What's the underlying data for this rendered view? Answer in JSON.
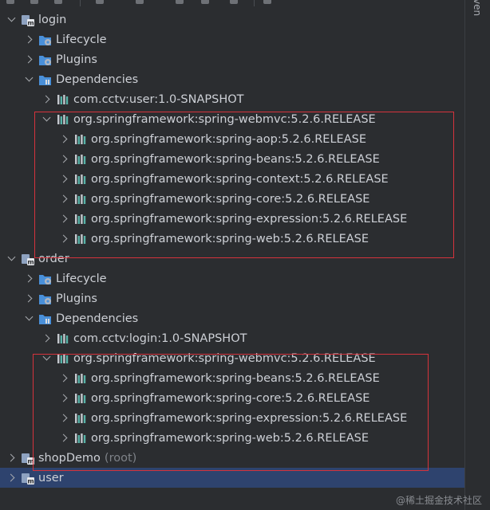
{
  "toolbar": {
    "icons": [
      "refresh-icon",
      "reimport-icon",
      "add-icon",
      "download-icon",
      "run-icon",
      "toggle-offline-icon",
      "settings-icon",
      "expand-icon"
    ]
  },
  "side_panel": {
    "label": "ven"
  },
  "colors": {
    "background": "#2b2d30",
    "selection": "#2e436e",
    "highlight_box": "#d5333c",
    "folder_blue": "#4a90d9",
    "module_gray": "#9aa0a6"
  },
  "tree": [
    {
      "indent": 0,
      "expanded": true,
      "icon": "maven-module-icon",
      "label": "login",
      "suffix": ""
    },
    {
      "indent": 1,
      "expanded": false,
      "icon": "lifecycle-icon",
      "label": "Lifecycle",
      "suffix": ""
    },
    {
      "indent": 1,
      "expanded": false,
      "icon": "plugins-icon",
      "label": "Plugins",
      "suffix": ""
    },
    {
      "indent": 1,
      "expanded": true,
      "icon": "dependencies-icon",
      "label": "Dependencies",
      "suffix": ""
    },
    {
      "indent": 2,
      "expanded": false,
      "icon": "library-icon",
      "label": "com.cctv:user:1.0-SNAPSHOT",
      "suffix": ""
    },
    {
      "indent": 2,
      "expanded": true,
      "icon": "library-icon",
      "label": "org.springframework:spring-webmvc:5.2.6.RELEASE",
      "suffix": ""
    },
    {
      "indent": 3,
      "expanded": false,
      "icon": "library-icon",
      "label": "org.springframework:spring-aop:5.2.6.RELEASE",
      "suffix": ""
    },
    {
      "indent": 3,
      "expanded": false,
      "icon": "library-icon",
      "label": "org.springframework:spring-beans:5.2.6.RELEASE",
      "suffix": ""
    },
    {
      "indent": 3,
      "expanded": false,
      "icon": "library-icon",
      "label": "org.springframework:spring-context:5.2.6.RELEASE",
      "suffix": ""
    },
    {
      "indent": 3,
      "expanded": false,
      "icon": "library-icon",
      "label": "org.springframework:spring-core:5.2.6.RELEASE",
      "suffix": ""
    },
    {
      "indent": 3,
      "expanded": false,
      "icon": "library-icon",
      "label": "org.springframework:spring-expression:5.2.6.RELEASE",
      "suffix": ""
    },
    {
      "indent": 3,
      "expanded": false,
      "icon": "library-icon",
      "label": "org.springframework:spring-web:5.2.6.RELEASE",
      "suffix": ""
    },
    {
      "indent": 0,
      "expanded": true,
      "icon": "maven-module-icon",
      "label": "order",
      "suffix": ""
    },
    {
      "indent": 1,
      "expanded": false,
      "icon": "lifecycle-icon",
      "label": "Lifecycle",
      "suffix": ""
    },
    {
      "indent": 1,
      "expanded": false,
      "icon": "plugins-icon",
      "label": "Plugins",
      "suffix": ""
    },
    {
      "indent": 1,
      "expanded": true,
      "icon": "dependencies-icon",
      "label": "Dependencies",
      "suffix": ""
    },
    {
      "indent": 2,
      "expanded": false,
      "icon": "library-icon",
      "label": "com.cctv:login:1.0-SNAPSHOT",
      "suffix": ""
    },
    {
      "indent": 2,
      "expanded": true,
      "icon": "library-icon",
      "label": "org.springframework:spring-webmvc:5.2.6.RELEASE",
      "suffix": ""
    },
    {
      "indent": 3,
      "expanded": false,
      "icon": "library-icon",
      "label": "org.springframework:spring-beans:5.2.6.RELEASE",
      "suffix": ""
    },
    {
      "indent": 3,
      "expanded": false,
      "icon": "library-icon",
      "label": "org.springframework:spring-core:5.2.6.RELEASE",
      "suffix": ""
    },
    {
      "indent": 3,
      "expanded": false,
      "icon": "library-icon",
      "label": "org.springframework:spring-expression:5.2.6.RELEASE",
      "suffix": ""
    },
    {
      "indent": 3,
      "expanded": false,
      "icon": "library-icon",
      "label": "org.springframework:spring-web:5.2.6.RELEASE",
      "suffix": ""
    },
    {
      "indent": 0,
      "expanded": false,
      "icon": "maven-module-icon",
      "label": "shopDemo",
      "suffix": "(root)"
    },
    {
      "indent": 0,
      "expanded": false,
      "icon": "maven-module-icon",
      "label": "user",
      "suffix": "",
      "selected": true
    }
  ],
  "watermark": "@稀土掘金技术社区"
}
